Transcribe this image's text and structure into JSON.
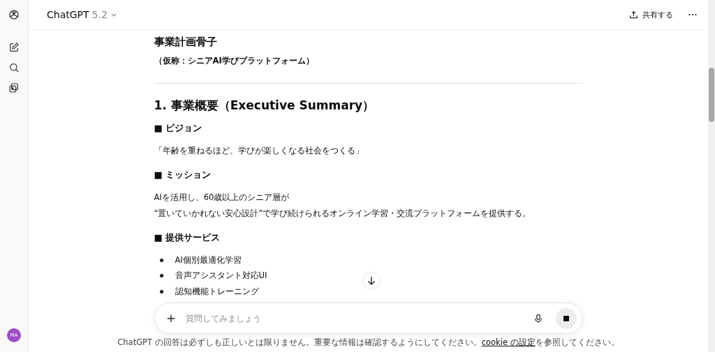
{
  "header": {
    "title": "ChatGPT",
    "version": "5.2",
    "share_label": "共有する"
  },
  "sidebar": {
    "avatar": "MA"
  },
  "document": [
    {
      "kind": "title",
      "text": "事業計画骨子"
    },
    {
      "kind": "subtitle",
      "text": "（仮称：シニアAI学びプラットフォーム）"
    },
    {
      "kind": "rule"
    },
    {
      "kind": "h2",
      "text": "1. 事業概要（Executive Summary）"
    },
    {
      "kind": "h3",
      "text": "■ ビジョン"
    },
    {
      "kind": "p",
      "lines": [
        "「年齢を重ねるほど、学びが楽しくなる社会をつくる」"
      ]
    },
    {
      "kind": "h3",
      "text": "■ ミッション"
    },
    {
      "kind": "p",
      "lines": [
        "AIを活用し、60歳以上のシニア層が",
        "“置いていかれない安心設計”で学び続けられるオンライン学習・交流プラットフォームを提供する。"
      ]
    },
    {
      "kind": "h3",
      "text": "■ 提供サービス"
    },
    {
      "kind": "list",
      "items": [
        "AI個別最適化学習",
        "音声アシスタント対応UI",
        "認知機能トレーニング"
      ]
    }
  ],
  "composer": {
    "placeholder": "質問してみましょう"
  },
  "footer": {
    "before": "ChatGPT の回答は必ずしも正しいとは限りません。重要な情報は確認するようにしてください。",
    "link": "cookie の設定",
    "after": "を参照してください。"
  }
}
